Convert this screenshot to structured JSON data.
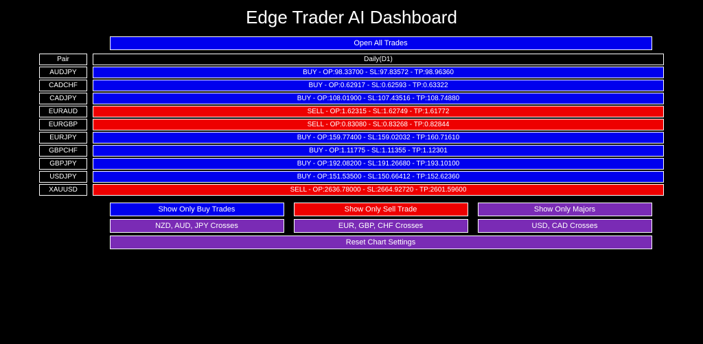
{
  "title": "Edge Trader AI Dashboard",
  "open_all": "Open All Trades",
  "header": {
    "pair": "Pair",
    "timeframe": "Daily(D1)"
  },
  "rows": [
    {
      "pair": "AUDJPY",
      "type": "buy",
      "text": "BUY - OP:98.33700 - SL:97.83572 - TP:98.96360"
    },
    {
      "pair": "CADCHF",
      "type": "buy",
      "text": "BUY - OP:0.62917 - SL:0.62593 - TP:0.63322"
    },
    {
      "pair": "CADJPY",
      "type": "buy",
      "text": "BUY - OP:108.01900 - SL:107.43516 - TP:108.74880"
    },
    {
      "pair": "EURAUD",
      "type": "sell",
      "text": "SELL - OP:1.62315 - SL:1.62749 - TP:1.61772"
    },
    {
      "pair": "EURGBP",
      "type": "sell",
      "text": "SELL - OP:0.83080 - SL:0.83268 - TP:0.82844"
    },
    {
      "pair": "EURJPY",
      "type": "buy",
      "text": "BUY - OP:159.77400 - SL:159.02032 - TP:160.71610"
    },
    {
      "pair": "GBPCHF",
      "type": "buy",
      "text": "BUY - OP:1.11775 - SL:1.11355 - TP:1.12301"
    },
    {
      "pair": "GBPJPY",
      "type": "buy",
      "text": "BUY - OP:192.08200 - SL:191.26680 - TP:193.10100"
    },
    {
      "pair": "USDJPY",
      "type": "buy",
      "text": "BUY - OP:151.53500 - SL:150.66412 - TP:152.62360"
    },
    {
      "pair": "XAUUSD",
      "type": "sell",
      "text": "SELL - OP:2636.78000 - SL:2664.92720 - TP:2601.59600"
    }
  ],
  "filters": {
    "buy": "Show Only Buy Trades",
    "sell": "Show Only Sell Trade",
    "majors": "Show Only Majors",
    "crosses1": "NZD, AUD, JPY Crosses",
    "crosses2": "EUR, GBP, CHF Crosses",
    "crosses3": "USD, CAD Crosses",
    "reset": "Reset Chart Settings"
  }
}
